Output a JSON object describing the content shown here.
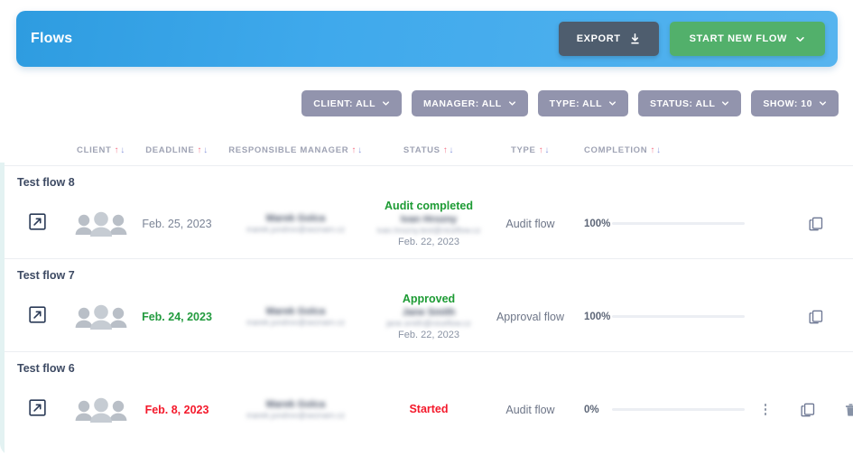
{
  "header": {
    "title": "Flows",
    "export_label": "EXPORT",
    "export_icon": "download-icon",
    "start_label": "START NEW FLOW",
    "start_icon": "chevron-down-icon",
    "gradient_from": "#2e9ce0",
    "gradient_to": "#56b4ef",
    "export_color": "#4e5d6e",
    "start_color": "#52b06b"
  },
  "filters": {
    "pill_color": "#9294ad",
    "items": [
      {
        "label": "CLIENT: ALL",
        "icon": "chevron-down-icon"
      },
      {
        "label": "MANAGER: ALL",
        "icon": "chevron-down-icon"
      },
      {
        "label": "TYPE: ALL",
        "icon": "chevron-down-icon"
      },
      {
        "label": "STATUS: ALL",
        "icon": "chevron-down-icon"
      },
      {
        "label": "SHOW: 10",
        "icon": "chevron-down-icon"
      }
    ]
  },
  "table": {
    "columns": [
      {
        "label": "CLIENT",
        "sortable": true
      },
      {
        "label": "DEADLINE",
        "sortable": true
      },
      {
        "label": "RESPONSIBLE MANAGER",
        "sortable": true
      },
      {
        "label": "STATUS",
        "sortable": true
      },
      {
        "label": "TYPE",
        "sortable": true
      },
      {
        "label": "COMPLETION",
        "sortable": true
      }
    ],
    "sort_up_color": "#f4768a",
    "sort_down_color": "#8e9bdd",
    "rows": [
      {
        "title": "Test flow 8",
        "open_icon": "external-link-icon",
        "avatars": 3,
        "deadline": "Feb. 25, 2023",
        "deadline_state": "normal",
        "manager_name": "Marek Golca",
        "manager_email": "marek.jundrov@seznam.cz",
        "status": "Audit completed",
        "status_state": "green",
        "status_person": "Ivan Hrozny",
        "status_email": "ivan.hrozny.test@niceflow.cz",
        "status_date": "Feb. 22, 2023",
        "type": "Audit flow",
        "completion_pct": "100%",
        "completion_value": 100,
        "actions": [
          "copy-icon"
        ]
      },
      {
        "title": "Test flow 7",
        "open_icon": "external-link-icon",
        "avatars": 3,
        "deadline": "Feb. 24, 2023",
        "deadline_state": "green",
        "manager_name": "Marek Golca",
        "manager_email": "marek.jundrov@seznam.cz",
        "status": "Approved",
        "status_state": "green",
        "status_person": "Jane Smith",
        "status_email": "jane.smith@niceflow.cz",
        "status_date": "Feb. 22, 2023",
        "type": "Approval flow",
        "completion_pct": "100%",
        "completion_value": 100,
        "actions": [
          "copy-icon"
        ]
      },
      {
        "title": "Test flow 6",
        "open_icon": "external-link-icon",
        "avatars": 3,
        "deadline": "Feb. 8, 2023",
        "deadline_state": "red",
        "manager_name": "Marek Golca",
        "manager_email": "marek.jundrov@seznam.cz",
        "status": "Started",
        "status_state": "red",
        "status_person": "",
        "status_email": "",
        "status_date": "",
        "type": "Audit flow",
        "completion_pct": "0%",
        "completion_value": 0,
        "actions": [
          "more-vertical-icon",
          "copy-icon",
          "trash-icon"
        ]
      }
    ]
  },
  "colors": {
    "green": "#1d9b34",
    "red": "#f4192b",
    "progress_green": "#2f9e41",
    "title_text": "#3d4a63",
    "muted_text": "#7b8496",
    "left_accent": "#e3f2f2"
  }
}
